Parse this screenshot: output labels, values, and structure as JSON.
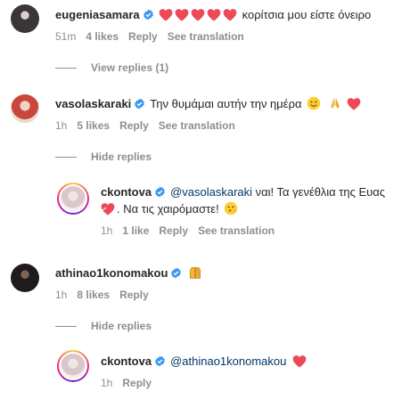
{
  "comments": [
    {
      "username": "eugeniasamara",
      "hearts": 5,
      "text": "κορίτσια μου είστε όνειρο",
      "time": "51m",
      "likes": "4 likes",
      "reply": "Reply",
      "translate": "See translation"
    },
    {
      "username": "vasolaskaraki",
      "text": "Την θυμάμαι αυτήν την ημέρα",
      "time": "1h",
      "likes": "5 likes",
      "reply": "Reply",
      "translate": "See translation"
    },
    {
      "username": "ckontova",
      "mention": "@vasolaskaraki",
      "text": " ναι! Τα γενέθλια της Ευας",
      "text2": ". Να τις χαιρόμαστε!",
      "time": "1h",
      "likes": "1 like",
      "reply": "Reply",
      "translate": "See translation"
    },
    {
      "username": "athinao1konomakou",
      "time": "1h",
      "likes": "8 likes",
      "reply": "Reply"
    },
    {
      "username": "ckontova",
      "mention": "@athinao1konomakou",
      "time": "1h",
      "reply": "Reply"
    }
  ],
  "view_replies_1": "View replies (1)",
  "hide_replies_1": "Hide replies",
  "hide_replies_2": "Hide replies",
  "colors": {
    "verified": "#3897f0",
    "heart": "#ed4956",
    "muted": "#8e8e8e",
    "mention": "#00376b"
  },
  "icons": [
    "verified-badge-icon",
    "red-heart-icon",
    "smiling-face-icon",
    "folded-hands-icon",
    "pleading-hands-icon",
    "winking-kiss-face-icon"
  ]
}
